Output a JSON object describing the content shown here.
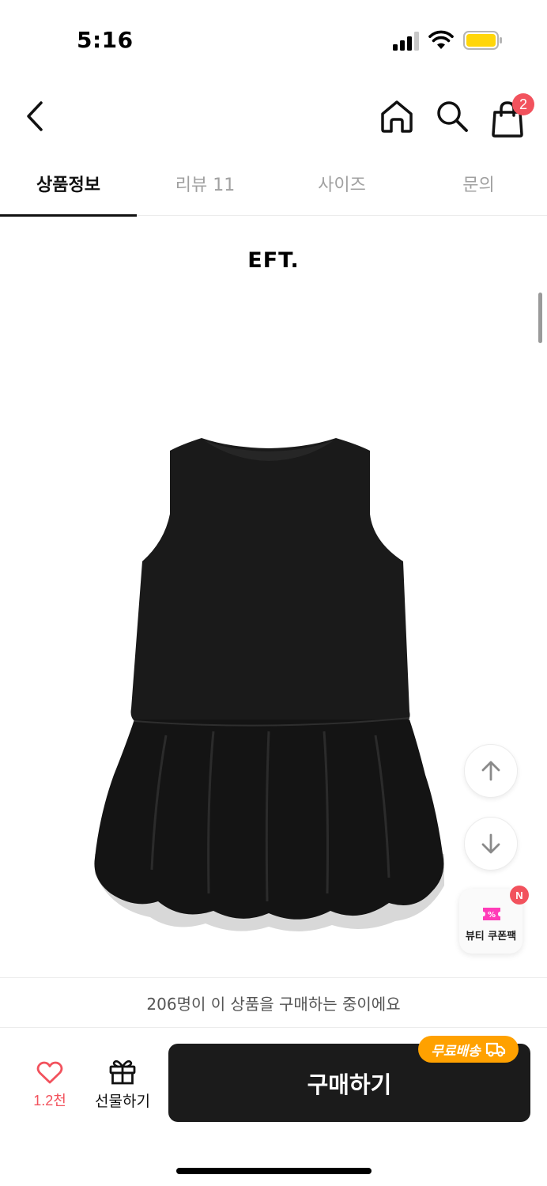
{
  "status_bar": {
    "time": "5:16"
  },
  "nav": {
    "cart_count": "2"
  },
  "tabs": [
    {
      "label": "상품정보",
      "active": true
    },
    {
      "label": "리뷰 11",
      "active": false
    },
    {
      "label": "사이즈",
      "active": false
    },
    {
      "label": "문의",
      "active": false
    }
  ],
  "content": {
    "brand_logo": "EFT."
  },
  "floating": {
    "coupon_label": "뷰티 쿠폰팩",
    "coupon_badge": "N",
    "coupon_icon_text": "%"
  },
  "purchase": {
    "notice": "206명이 이 상품을 구매하는 중이에요",
    "like_count": "1.2천",
    "gift_label": "선물하기",
    "buy_label": "구매하기",
    "free_shipping": "무료배송"
  },
  "colors": {
    "accent_red": "#f2525d",
    "badge_orange": "#ffa100",
    "buy_button": "#1b1b1b",
    "battery_fill": "#ffd60a"
  },
  "icons": {
    "back": "chevron-left-icon",
    "home": "home-icon",
    "search": "search-icon",
    "cart": "shopping-bag-icon",
    "scroll_up": "arrow-up-icon",
    "scroll_down": "arrow-down-icon",
    "like": "heart-icon",
    "gift": "gift-icon",
    "truck": "truck-icon"
  }
}
